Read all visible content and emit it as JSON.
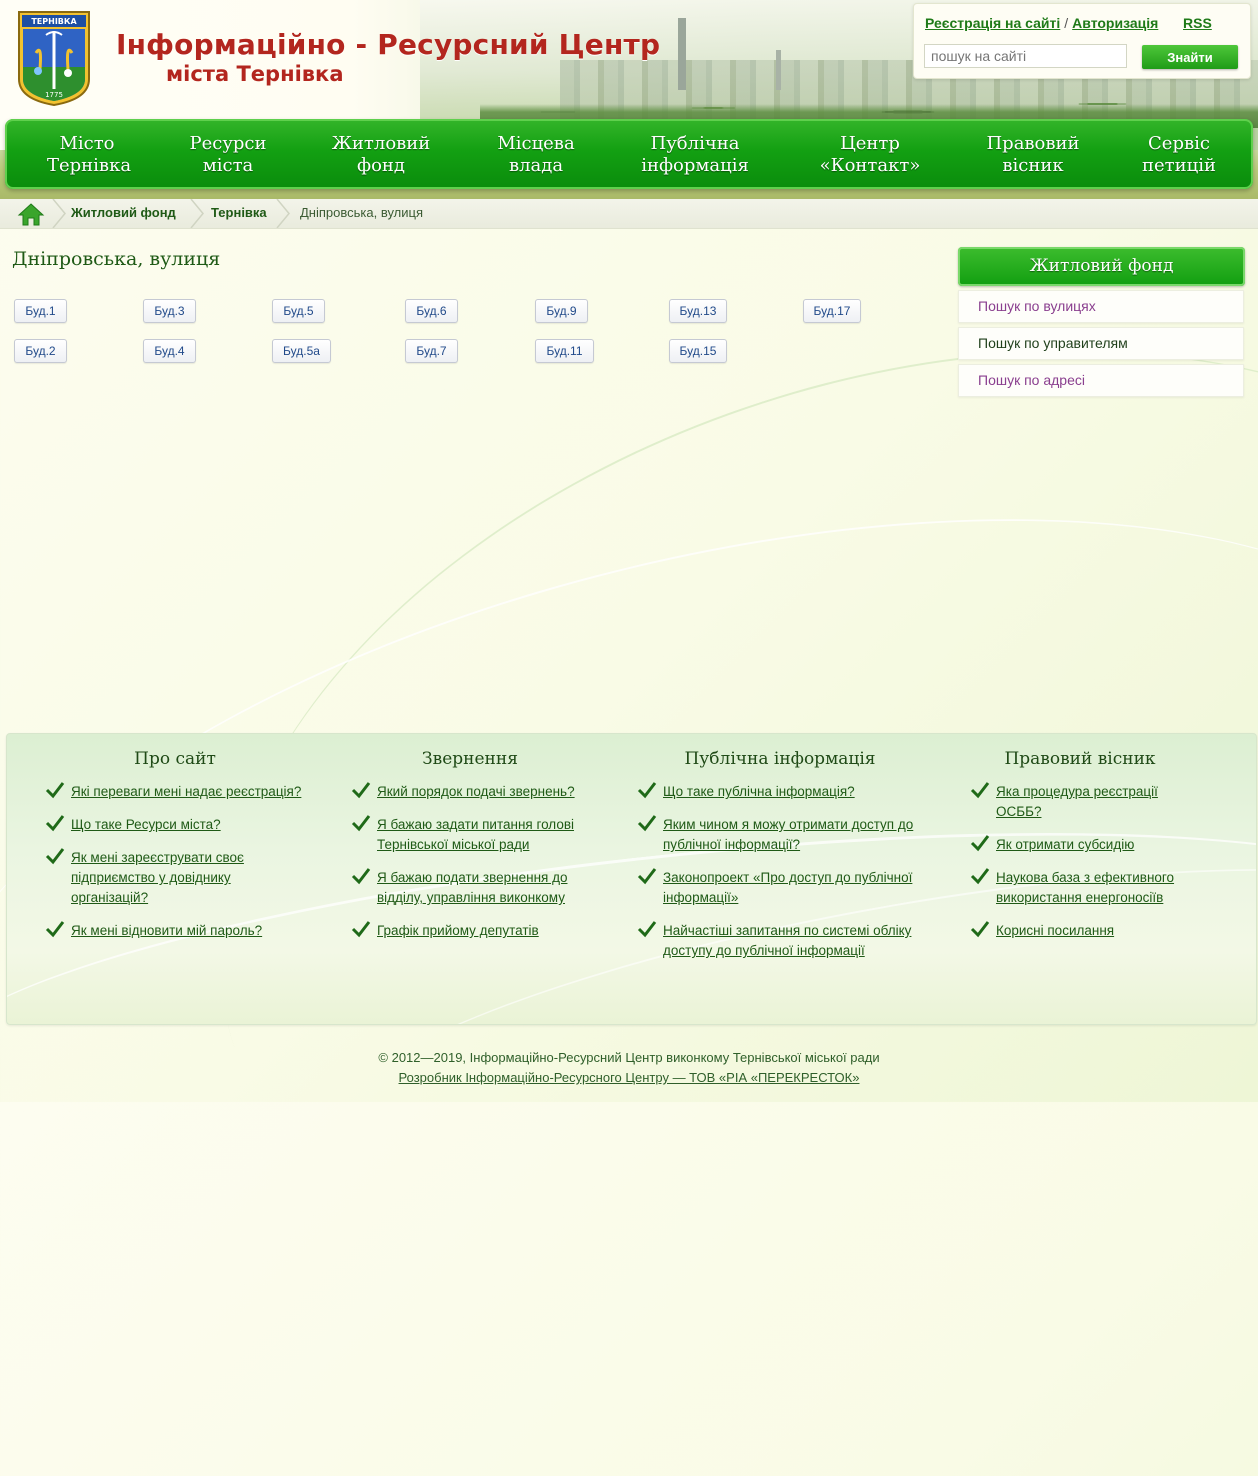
{
  "site": {
    "title_line1": "Інформаційно - Ресурсний  Центр",
    "title_line2": "міста Тернівка",
    "logo_text": "ТЕРНІВКА",
    "logo_year": "1775"
  },
  "auth": {
    "register": "Реєстрація на сайті",
    "separator": "/",
    "login": "Авторизація",
    "rss": "RSS"
  },
  "search": {
    "placeholder": "пошук на сайті",
    "button": "Знайти"
  },
  "nav": [
    {
      "line1": "Місто",
      "line2": "Тернівка"
    },
    {
      "line1": "Ресурси",
      "line2": "міста"
    },
    {
      "line1": "Житловий",
      "line2": "фонд"
    },
    {
      "line1": "Місцева",
      "line2": "влада"
    },
    {
      "line1": "Публічна",
      "line2": "інформація"
    },
    {
      "line1": "Центр",
      "line2": "«Контакт»"
    },
    {
      "line1": "Правовий",
      "line2": "вісник"
    },
    {
      "line1": "Сервіс",
      "line2": "петицій"
    }
  ],
  "breadcrumb": [
    "Житловий фонд",
    "Тернівка",
    "Дніпровська, вулиця"
  ],
  "page_title": "Дніпровська, вулиця",
  "buildings": {
    "row1": [
      "Буд.1",
      "Буд.3",
      "Буд.5",
      "Буд.6",
      "Буд.9",
      "Буд.13",
      "Буд.17"
    ],
    "row2": [
      "Буд.2",
      "Буд.4",
      "Буд.5а",
      "Буд.7",
      "Буд.11",
      "Буд.15"
    ]
  },
  "sidebar": {
    "title": "Житловий фонд",
    "items": [
      "Пошук по вулицях",
      "Пошук по управителям",
      "Пошук по адресі"
    ]
  },
  "footer_columns": [
    {
      "title": "Про сайт",
      "items": [
        "Які переваги мені надає реєстрація?",
        "Що таке Ресурси міста?",
        "Як мені зареєструвати своє підприємство у довіднику організацій?",
        "Як мені відновити мій пароль?"
      ]
    },
    {
      "title": "Звернення",
      "items": [
        "Який порядок подачі звернень?",
        "Я бажаю задати питання голові Тернівської міської ради",
        "Я бажаю подати звернення до відділу, управління виконкому",
        "Графік прийому депутатів"
      ]
    },
    {
      "title": "Публічна інформація",
      "items": [
        "Що таке публічна інформація?",
        "Яким чином я можу отримати доступ до публічної інформації?",
        "Законопроект «Про доступ до публічної інформації»",
        "Найчастіші запитання по системі обліку доступу до публічної інформації"
      ]
    },
    {
      "title": "Правовий вісник",
      "items": [
        "Яка процедура реєстрації ОСББ?",
        "Як отримати субсидію",
        "Наукова база з ефективного використання енергоносіїв",
        "Корисні посилання"
      ]
    }
  ],
  "copyright": "© 2012—2019, Інформаційно-Ресурсний Центр виконкому Тернівської міської ради",
  "developer": "Розробник Інформаційно-Ресурсного Центру — ТОВ «РІА «ПЕРЕКРЕСТОК»",
  "colors": {
    "brand_red": "#b3261e",
    "brand_green": "#13a012",
    "link_green": "#1f5a16"
  }
}
